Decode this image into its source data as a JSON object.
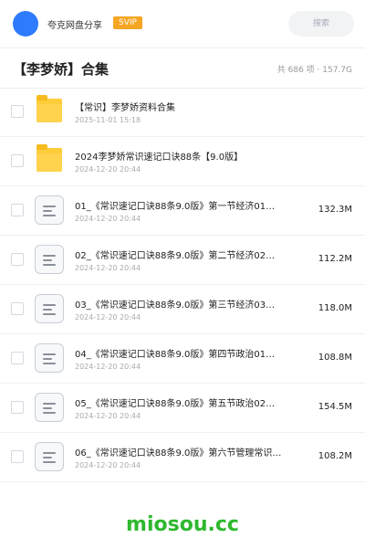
{
  "header": {
    "app_name": "夸克网盘分享",
    "svip_badge": "SVIP",
    "search_placeholder": "搜索"
  },
  "page": {
    "title": "【李梦娇】合集",
    "meta": "共 686 项 · 157.7G"
  },
  "files": [
    {
      "type": "folder",
      "name": "【常识】李梦娇资料合集",
      "date": "2025-11-01 15:18",
      "size": ""
    },
    {
      "type": "folder",
      "name": "2024李梦娇常识速记口诀88条【9.0版】",
      "date": "2024-12-20 20:44",
      "size": ""
    },
    {
      "type": "doc",
      "name": "01_《常识速记口诀88条9.0版》第一节经济01…",
      "date": "2024-12-20 20:44",
      "size": "132.3M"
    },
    {
      "type": "doc",
      "name": "02_《常识速记口诀88条9.0版》第二节经济02…",
      "date": "2024-12-20 20:44",
      "size": "112.2M"
    },
    {
      "type": "doc",
      "name": "03_《常识速记口诀88条9.0版》第三节经济03…",
      "date": "2024-12-20 20:44",
      "size": "118.0M"
    },
    {
      "type": "doc",
      "name": "04_《常识速记口诀88条9.0版》第四节政治01…",
      "date": "2024-12-20 20:44",
      "size": "108.8M"
    },
    {
      "type": "doc",
      "name": "05_《常识速记口诀88条9.0版》第五节政治02…",
      "date": "2024-12-20 20:44",
      "size": "154.5M"
    },
    {
      "type": "doc",
      "name": "06_《常识速记口诀88条9.0版》第六节管理常识…",
      "date": "2024-12-20 20:44",
      "size": "108.2M"
    }
  ],
  "watermark": "miosou.cc",
  "colors": {
    "avatar": "#2f7bff",
    "svip": "#f5a623",
    "folder": "#ffcc3a",
    "watermark": "#2eb82e"
  }
}
